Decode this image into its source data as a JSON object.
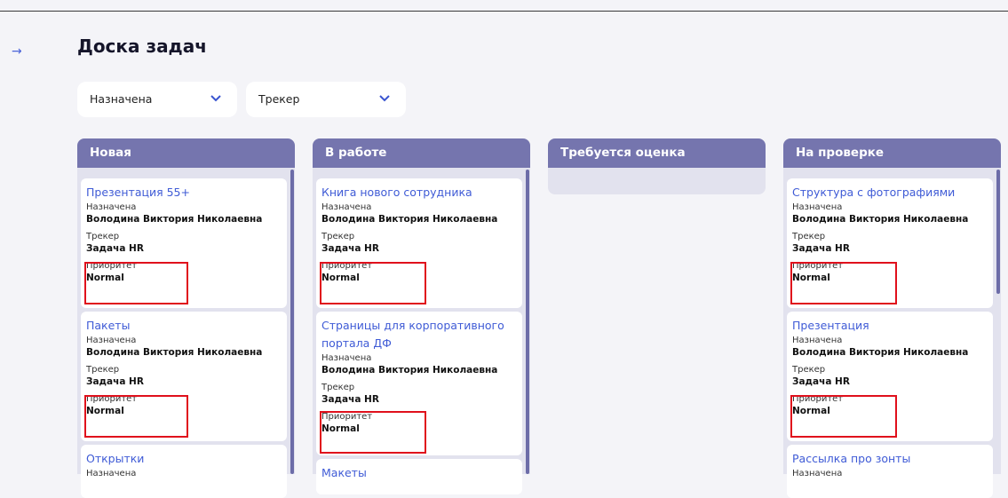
{
  "page": {
    "title": "Доска задач"
  },
  "filters": [
    {
      "label": "Назначена"
    },
    {
      "label": "Трекер"
    }
  ],
  "field_labels": {
    "assignee": "Назначена",
    "tracker": "Трекер",
    "priority": "Приоритет"
  },
  "columns": [
    {
      "title": "Новая",
      "cards": [
        {
          "title": "Презентация 55+",
          "assignee": "Володина Виктория Николаевна",
          "tracker": "Задача HR",
          "priority": "Normal"
        },
        {
          "title": "Пакеты",
          "assignee": "Володина Виктория Николаевна",
          "tracker": "Задача HR",
          "priority": "Normal"
        },
        {
          "title": "Открытки"
        }
      ]
    },
    {
      "title": "В работе",
      "cards": [
        {
          "title": "Книга нового сотрудника",
          "assignee": "Володина Виктория Николаевна",
          "tracker": "Задача HR",
          "priority": "Normal"
        },
        {
          "title_lines": [
            "Страницы для корпоративного",
            "портала ДФ"
          ],
          "assignee": "Володина Виктория Николаевна",
          "tracker": "Задача HR",
          "priority": "Normal"
        },
        {
          "title": "Макеты"
        }
      ]
    },
    {
      "title": "Требуется оценка",
      "cards": []
    },
    {
      "title": "На проверке",
      "cards": [
        {
          "title": "Структура с фотографиями",
          "assignee": "Володина Виктория Николаевна",
          "tracker": "Задача HR",
          "priority": "Normal"
        },
        {
          "title": "Презентация",
          "assignee": "Володина Виктория Николаевна",
          "tracker": "Задача HR",
          "priority": "Normal"
        },
        {
          "title": "Рассылка про зонты",
          "assignee_label_only": true
        }
      ]
    }
  ],
  "colors": {
    "accent": "#7575ae",
    "link": "#3f5bd6",
    "highlight": "#e0101c"
  },
  "icons": {
    "expand": "arrow-right-icon",
    "dropdown": "chevron-down-icon"
  }
}
